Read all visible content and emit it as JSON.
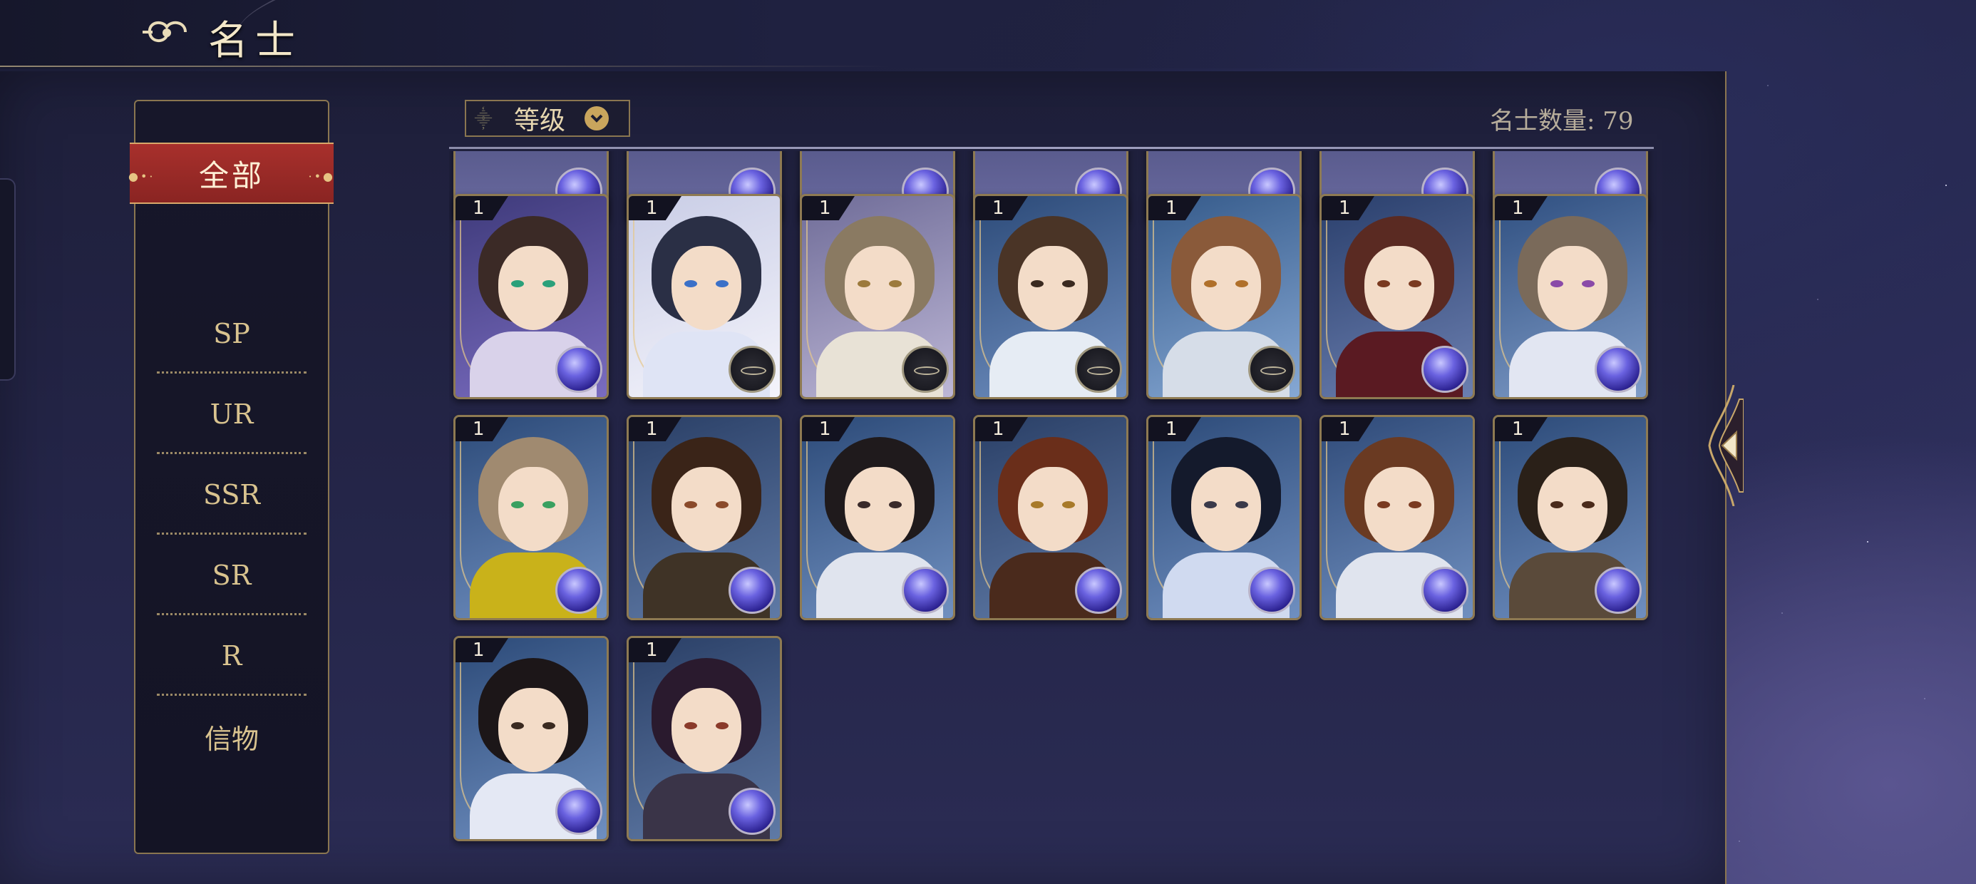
{
  "header": {
    "title": "名士"
  },
  "sidebar": {
    "items": [
      {
        "label": "全部",
        "selected": true
      },
      {
        "label": "SP"
      },
      {
        "label": "UR"
      },
      {
        "label": "SSR"
      },
      {
        "label": "SR"
      },
      {
        "label": "R"
      },
      {
        "label": "信物"
      }
    ]
  },
  "toolbar": {
    "sort_label": "等级",
    "count_label": "名士数量:",
    "count_value": "79"
  },
  "colors": {
    "accent_gold": "#d9c38f",
    "selected_tab_red": "#a8302c",
    "panel_bg": "#1e1f3a"
  },
  "cards": [
    {
      "level": "1",
      "badge": "orb",
      "palette": "violet-brunette"
    },
    {
      "level": "1",
      "badge": "compass",
      "palette": "white-veil"
    },
    {
      "level": "1",
      "badge": "compass",
      "palette": "light-brown-flower"
    },
    {
      "level": "1",
      "badge": "compass",
      "palette": "long-brown-scholar"
    },
    {
      "level": "1",
      "badge": "compass",
      "palette": "short-brown"
    },
    {
      "level": "1",
      "badge": "orb",
      "palette": "red-ribbon"
    },
    {
      "level": "1",
      "badge": "orb",
      "palette": "twin-bun-lilac"
    },
    {
      "level": "1",
      "badge": "orb",
      "palette": "child-yellow"
    },
    {
      "level": "1",
      "badge": "orb",
      "palette": "dark-brown-smile"
    },
    {
      "level": "1",
      "badge": "orb",
      "palette": "black-hair"
    },
    {
      "level": "1",
      "badge": "orb",
      "palette": "auburn-ponytail"
    },
    {
      "level": "1",
      "badge": "orb",
      "palette": "blue-black-long"
    },
    {
      "level": "1",
      "badge": "orb",
      "palette": "red-headband"
    },
    {
      "level": "1",
      "badge": "orb",
      "palette": "bearded"
    },
    {
      "level": "1",
      "badge": "orb",
      "palette": "topknot"
    },
    {
      "level": "1",
      "badge": "orb",
      "palette": "dark-purple-long"
    }
  ]
}
